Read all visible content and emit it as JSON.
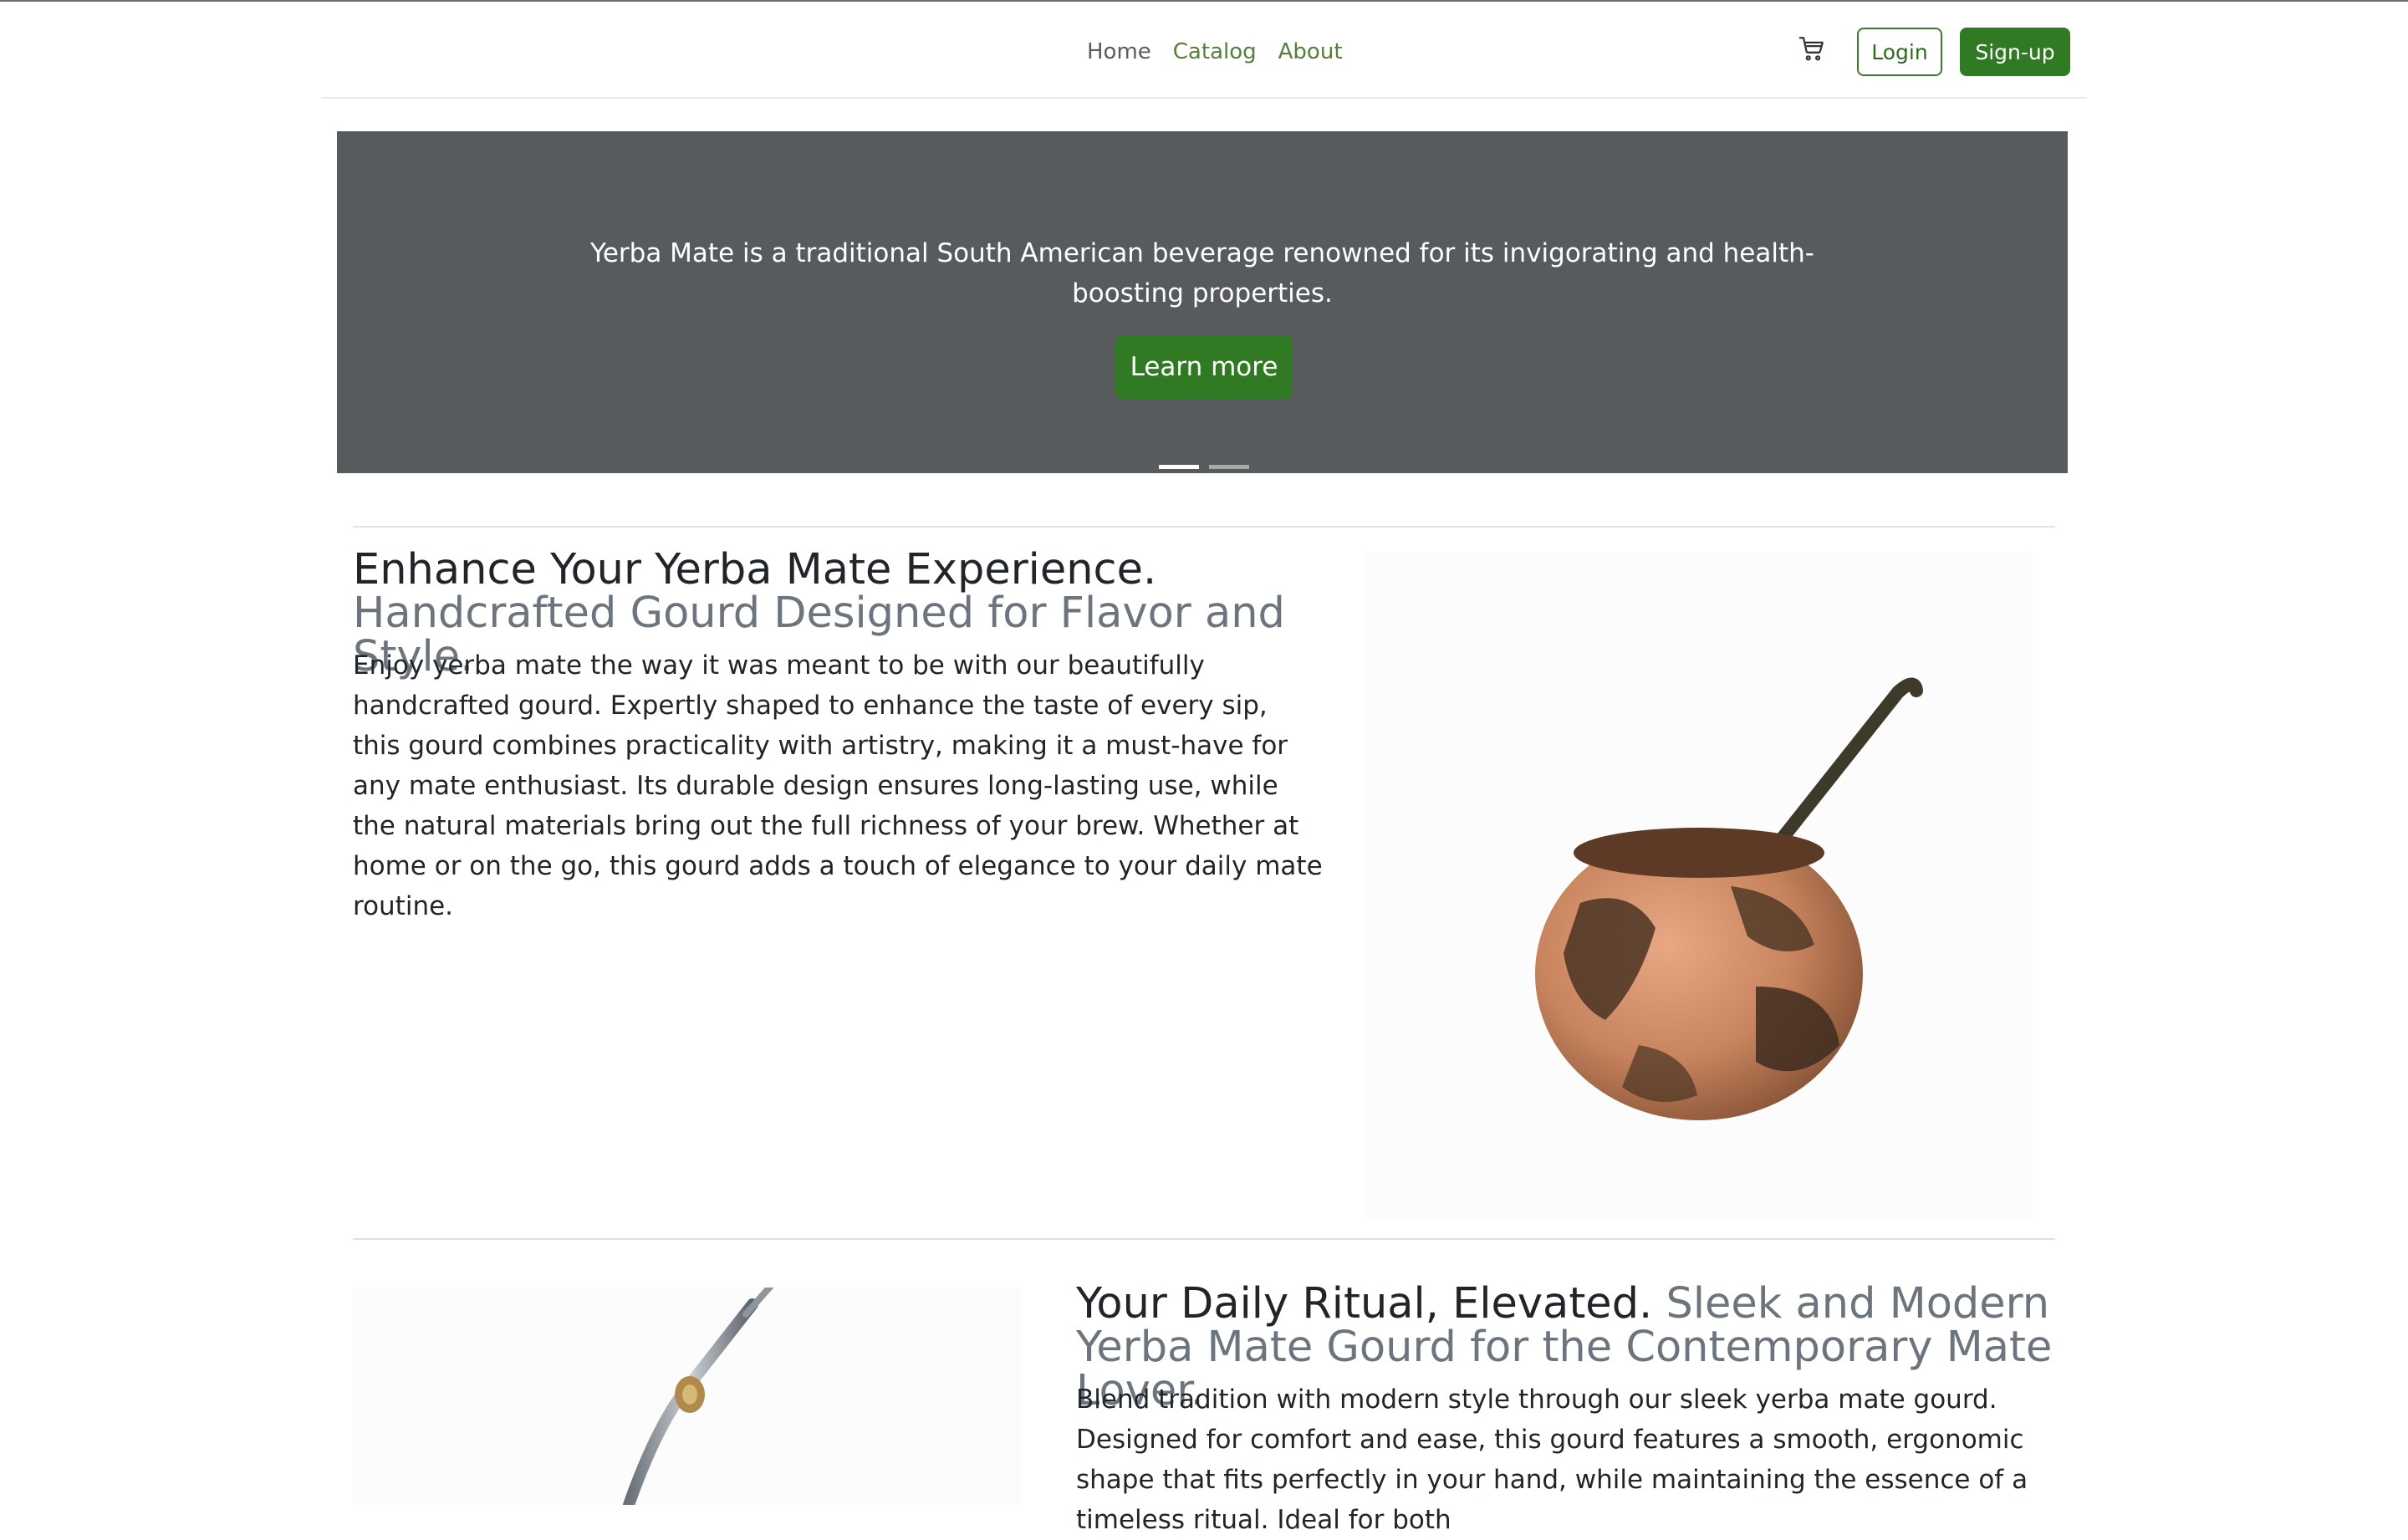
{
  "nav": {
    "links": [
      "Home",
      "Catalog",
      "About"
    ],
    "login_label": "Login",
    "signup_label": "Sign-up"
  },
  "hero": {
    "text": "Yerba Mate is a traditional South American beverage renowned for its invigorating and health-boosting properties.",
    "button_label": "Learn more",
    "slides": 2,
    "active_slide": 1
  },
  "features": [
    {
      "title": "Enhance Your Yerba Mate Experience.",
      "subtitle": "Handcrafted Gourd Designed for Flavor and Style.",
      "description": "Enjoy yerba mate the way it was meant to be with our beautifully handcrafted gourd. Expertly shaped to enhance the taste of every sip, this gourd combines practicality with artistry, making it a must-have for any mate enthusiast. Its durable design ensures long-lasting use, while the natural materials bring out the full richness of your brew. Whether at home or on the go, this gourd adds a touch of elegance to your daily mate routine."
    },
    {
      "title": "Your Daily Ritual, Elevated.",
      "subtitle": "Sleek and Modern Yerba Mate Gourd for the Contemporary Mate Lover.",
      "description": "Blend tradition with modern style through our sleek yerba mate gourd. Designed for comfort and ease, this gourd features a smooth, ergonomic shape that fits perfectly in your hand, while maintaining the essence of a timeless ritual. Ideal for both"
    }
  ],
  "colors": {
    "brand_green": "#2f7a22",
    "link_green": "#54803c",
    "hero_bg": "#585b5d"
  },
  "icons": [
    "cart-icon"
  ]
}
